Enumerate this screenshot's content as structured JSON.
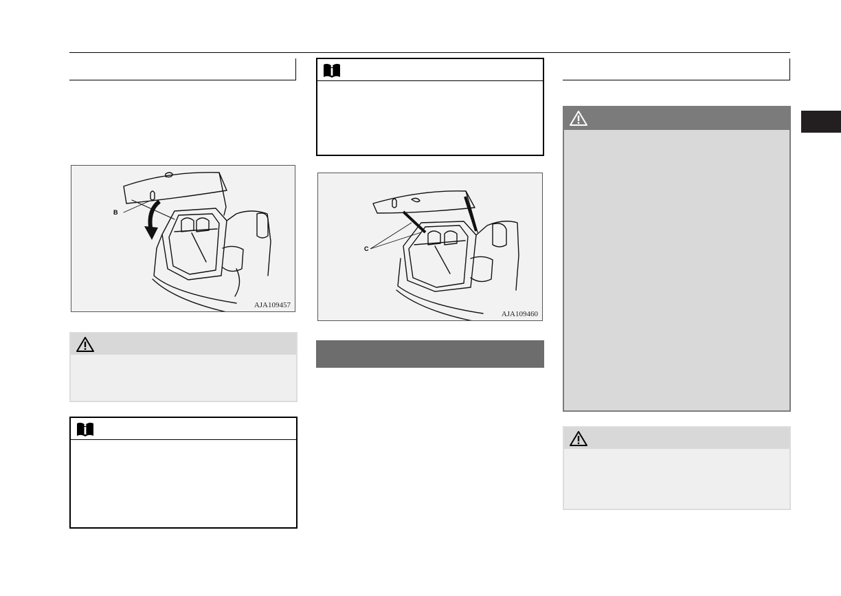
{
  "figures": {
    "left": {
      "code": "AJA109457",
      "callout": "B"
    },
    "middle": {
      "code": "AJA109460",
      "callout": "C"
    }
  },
  "icons": {
    "warning": "warning-triangle-icon",
    "note": "note-book-icon"
  },
  "colors": {
    "warning_dark_bar": "#7b7b7b",
    "warning_light_bar": "#d8d8d8",
    "section_band": "#6d6d6d",
    "thumb_tab": "#231f20"
  }
}
